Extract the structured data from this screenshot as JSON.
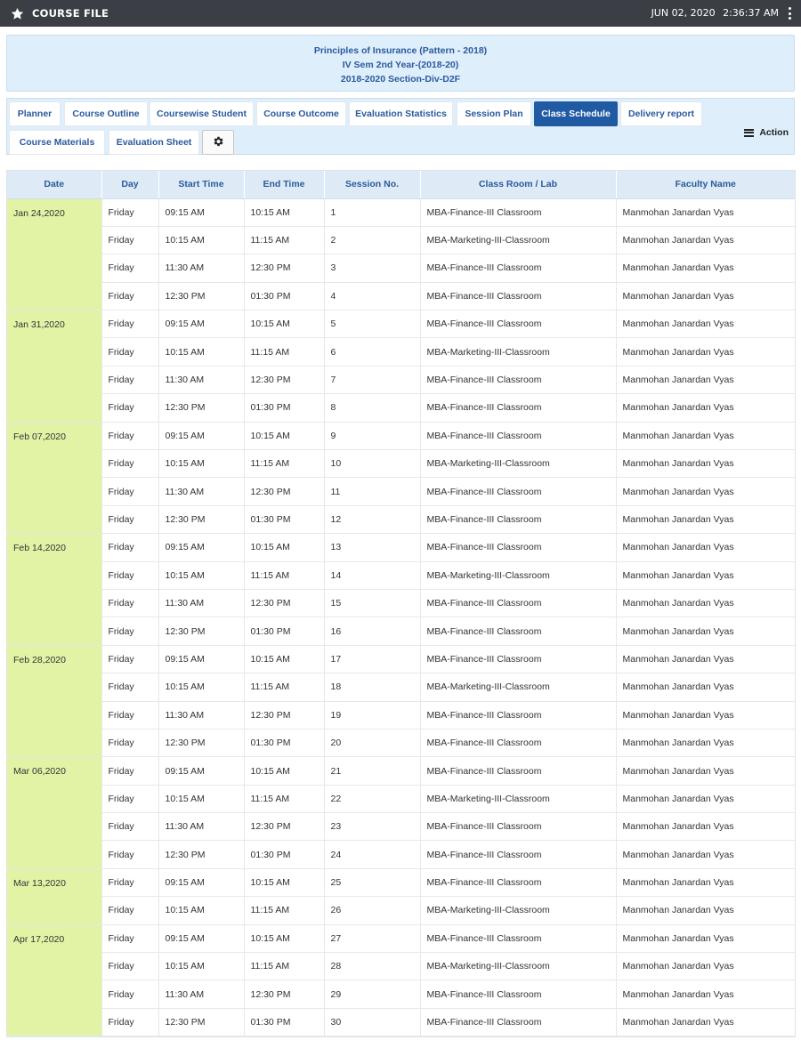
{
  "topbar": {
    "title": "COURSE FILE",
    "date": "JUN 02, 2020",
    "time": "2:36:37 AM",
    "star_icon": "star-icon",
    "menu_icon": "kebab-menu-icon"
  },
  "course": {
    "name": "Principles of Insurance (Pattern - 2018)",
    "semester": "IV Sem 2nd Year-(2018-20)",
    "section": "2018-2020 Section-Div-D2F"
  },
  "tabs": [
    {
      "label": "Planner"
    },
    {
      "label": "Course Outline"
    },
    {
      "label": "Coursewise Student"
    },
    {
      "label": "Course Outcome"
    },
    {
      "label": "Evaluation Statistics"
    },
    {
      "label": "Session Plan"
    },
    {
      "label": "Class Schedule",
      "active": true
    },
    {
      "label": "Delivery report"
    },
    {
      "label": "Course Materials"
    },
    {
      "label": "Evaluation Sheet"
    }
  ],
  "settings_icon": "gear-icon",
  "action": {
    "label": "Action",
    "icon": "hamburger-icon"
  },
  "colors": {
    "topbar": "#3b3f45",
    "accent": "#1f5aa3",
    "header_bg": "#dfeefb",
    "date_cell": "#e2f3a6"
  },
  "table": {
    "columns": [
      "Date",
      "Day",
      "Start Time",
      "End Time",
      "Session No.",
      "Class Room / Lab",
      "Faculty Name"
    ],
    "groups": [
      {
        "date": "Jan 24,2020",
        "rows": [
          [
            "Friday",
            "09:15 AM",
            "10:15 AM",
            "1",
            "MBA-Finance-III Classroom",
            "Manmohan Janardan Vyas"
          ],
          [
            "Friday",
            "10:15 AM",
            "11:15 AM",
            "2",
            "MBA-Marketing-III-Classroom",
            "Manmohan Janardan Vyas"
          ],
          [
            "Friday",
            "11:30 AM",
            "12:30 PM",
            "3",
            "MBA-Finance-III Classroom",
            "Manmohan Janardan Vyas"
          ],
          [
            "Friday",
            "12:30 PM",
            "01:30 PM",
            "4",
            "MBA-Finance-III Classroom",
            "Manmohan Janardan Vyas"
          ]
        ]
      },
      {
        "date": "Jan 31,2020",
        "rows": [
          [
            "Friday",
            "09:15 AM",
            "10:15 AM",
            "5",
            "MBA-Finance-III Classroom",
            "Manmohan Janardan Vyas"
          ],
          [
            "Friday",
            "10:15 AM",
            "11:15 AM",
            "6",
            "MBA-Marketing-III-Classroom",
            "Manmohan Janardan Vyas"
          ],
          [
            "Friday",
            "11:30 AM",
            "12:30 PM",
            "7",
            "MBA-Finance-III Classroom",
            "Manmohan Janardan Vyas"
          ],
          [
            "Friday",
            "12:30 PM",
            "01:30 PM",
            "8",
            "MBA-Finance-III Classroom",
            "Manmohan Janardan Vyas"
          ]
        ]
      },
      {
        "date": "Feb 07,2020",
        "rows": [
          [
            "Friday",
            "09:15 AM",
            "10:15 AM",
            "9",
            "MBA-Finance-III Classroom",
            "Manmohan Janardan Vyas"
          ],
          [
            "Friday",
            "10:15 AM",
            "11:15 AM",
            "10",
            "MBA-Marketing-III-Classroom",
            "Manmohan Janardan Vyas"
          ],
          [
            "Friday",
            "11:30 AM",
            "12:30 PM",
            "11",
            "MBA-Finance-III Classroom",
            "Manmohan Janardan Vyas"
          ],
          [
            "Friday",
            "12:30 PM",
            "01:30 PM",
            "12",
            "MBA-Finance-III Classroom",
            "Manmohan Janardan Vyas"
          ]
        ]
      },
      {
        "date": "Feb 14,2020",
        "rows": [
          [
            "Friday",
            "09:15 AM",
            "10:15 AM",
            "13",
            "MBA-Finance-III Classroom",
            "Manmohan Janardan Vyas"
          ],
          [
            "Friday",
            "10:15 AM",
            "11:15 AM",
            "14",
            "MBA-Marketing-III-Classroom",
            "Manmohan Janardan Vyas"
          ],
          [
            "Friday",
            "11:30 AM",
            "12:30 PM",
            "15",
            "MBA-Finance-III Classroom",
            "Manmohan Janardan Vyas"
          ],
          [
            "Friday",
            "12:30 PM",
            "01:30 PM",
            "16",
            "MBA-Finance-III Classroom",
            "Manmohan Janardan Vyas"
          ]
        ]
      },
      {
        "date": "Feb 28,2020",
        "rows": [
          [
            "Friday",
            "09:15 AM",
            "10:15 AM",
            "17",
            "MBA-Finance-III Classroom",
            "Manmohan Janardan Vyas"
          ],
          [
            "Friday",
            "10:15 AM",
            "11:15 AM",
            "18",
            "MBA-Marketing-III-Classroom",
            "Manmohan Janardan Vyas"
          ],
          [
            "Friday",
            "11:30 AM",
            "12:30 PM",
            "19",
            "MBA-Finance-III Classroom",
            "Manmohan Janardan Vyas"
          ],
          [
            "Friday",
            "12:30 PM",
            "01:30 PM",
            "20",
            "MBA-Finance-III Classroom",
            "Manmohan Janardan Vyas"
          ]
        ]
      },
      {
        "date": "Mar 06,2020",
        "rows": [
          [
            "Friday",
            "09:15 AM",
            "10:15 AM",
            "21",
            "MBA-Finance-III Classroom",
            "Manmohan Janardan Vyas"
          ],
          [
            "Friday",
            "10:15 AM",
            "11:15 AM",
            "22",
            "MBA-Marketing-III-Classroom",
            "Manmohan Janardan Vyas"
          ],
          [
            "Friday",
            "11:30 AM",
            "12:30 PM",
            "23",
            "MBA-Finance-III Classroom",
            "Manmohan Janardan Vyas"
          ],
          [
            "Friday",
            "12:30 PM",
            "01:30 PM",
            "24",
            "MBA-Finance-III Classroom",
            "Manmohan Janardan Vyas"
          ]
        ]
      },
      {
        "date": "Mar 13,2020",
        "rows": [
          [
            "Friday",
            "09:15 AM",
            "10:15 AM",
            "25",
            "MBA-Finance-III Classroom",
            "Manmohan Janardan Vyas"
          ],
          [
            "Friday",
            "10:15 AM",
            "11:15 AM",
            "26",
            "MBA-Marketing-III-Classroom",
            "Manmohan Janardan Vyas"
          ]
        ]
      },
      {
        "date": "Apr 17,2020",
        "rows": [
          [
            "Friday",
            "09:15 AM",
            "10:15 AM",
            "27",
            "MBA-Finance-III Classroom",
            "Manmohan Janardan Vyas"
          ],
          [
            "Friday",
            "10:15 AM",
            "11:15 AM",
            "28",
            "MBA-Marketing-III-Classroom",
            "Manmohan Janardan Vyas"
          ],
          [
            "Friday",
            "11:30 AM",
            "12:30 PM",
            "29",
            "MBA-Finance-III Classroom",
            "Manmohan Janardan Vyas"
          ],
          [
            "Friday",
            "12:30 PM",
            "01:30 PM",
            "30",
            "MBA-Finance-III Classroom",
            "Manmohan Janardan Vyas"
          ]
        ]
      }
    ]
  }
}
